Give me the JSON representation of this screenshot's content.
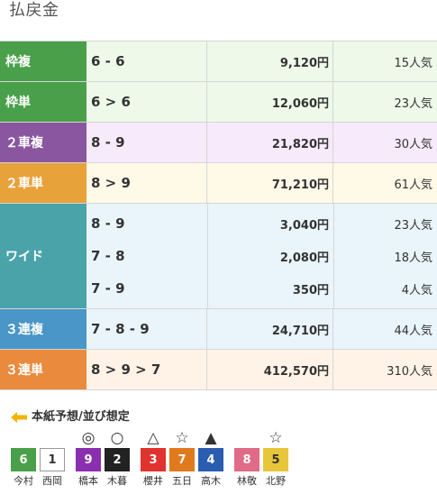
{
  "title": "払戻金",
  "colors": {
    "wakufuku": "#4aa04a",
    "wakutan": "#4aa04a",
    "nishafuku": "#8a56a0",
    "nishatan": "#e8a23a",
    "wide": "#4aa3a8",
    "sanrenpuku": "#4a96c8",
    "sanrentan": "#ea8a3c",
    "tint_green": "#eef9e9",
    "tint_purple": "#f7eafb",
    "tint_yellow": "#fff9e8",
    "tint_cyan": "#e9f5fb",
    "tint_blue": "#eaf4fb",
    "tint_orange": "#fff3e7"
  },
  "payouts": [
    {
      "type": "枠複",
      "lines": [
        {
          "combo": "6 - 6",
          "payout": "9,120円",
          "popularity": "15人気"
        }
      ]
    },
    {
      "type": "枠単",
      "lines": [
        {
          "combo": "6 > 6",
          "payout": "12,060円",
          "popularity": "23人気"
        }
      ]
    },
    {
      "type": "２車複",
      "lines": [
        {
          "combo": "8 - 9",
          "payout": "21,820円",
          "popularity": "30人気"
        }
      ]
    },
    {
      "type": "２車単",
      "lines": [
        {
          "combo": "8 > 9",
          "payout": "71,210円",
          "popularity": "61人気"
        }
      ]
    },
    {
      "type": "ワイド",
      "lines": [
        {
          "combo": "8 - 9",
          "payout": "3,040円",
          "popularity": "23人気"
        },
        {
          "combo": "7 - 8",
          "payout": "2,080円",
          "popularity": "18人気"
        },
        {
          "combo": "7 - 9",
          "payout": "350円",
          "popularity": "4人気"
        }
      ]
    },
    {
      "type": "３連複",
      "lines": [
        {
          "combo": "7 - 8 - 9",
          "payout": "24,710円",
          "popularity": "44人気"
        }
      ]
    },
    {
      "type": "３連単",
      "lines": [
        {
          "combo": "8 > 9 > 7",
          "payout": "412,570円",
          "popularity": "310人気"
        }
      ]
    }
  ],
  "prediction": {
    "title": "本紙予想/並び想定",
    "bikes": [
      {
        "number": "6",
        "name": "今村",
        "mark": "",
        "color": "#4aa04a",
        "text_color": "#ffffff"
      },
      {
        "number": "1",
        "name": "西岡",
        "mark": "",
        "color": "#ffffff",
        "text_color": "#333333"
      },
      {
        "number": "9",
        "name": "橋本",
        "mark": "◎",
        "color": "#8a2fb0",
        "text_color": "#ffffff"
      },
      {
        "number": "2",
        "name": "木暮",
        "mark": "○",
        "color": "#222222",
        "text_color": "#ffffff"
      },
      {
        "number": "3",
        "name": "櫻井",
        "mark": "△",
        "color": "#e0322e",
        "text_color": "#ffffff"
      },
      {
        "number": "7",
        "name": "五日",
        "mark": "☆",
        "color": "#e07a1c",
        "text_color": "#ffffff"
      },
      {
        "number": "4",
        "name": "高木",
        "mark": "▲",
        "color": "#2a5cb0",
        "text_color": "#ffffff"
      },
      {
        "number": "8",
        "name": "林敬",
        "mark": "",
        "color": "#e06a88",
        "text_color": "#ffffff"
      },
      {
        "number": "5",
        "name": "北野",
        "mark": "☆",
        "color": "#e8c63a",
        "text_color": "#333333"
      }
    ]
  }
}
